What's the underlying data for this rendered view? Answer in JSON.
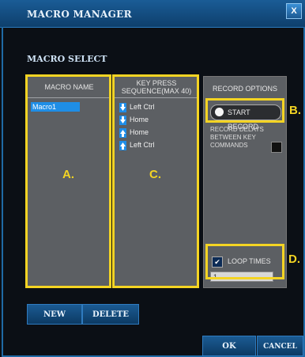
{
  "window": {
    "title": "MACRO MANAGER",
    "close_label": "X"
  },
  "section_title": "MACRO SELECT",
  "macro_list": {
    "header": "MACRO NAME",
    "items": [
      {
        "label": "Macro1",
        "selected": true
      }
    ]
  },
  "key_sequence": {
    "header_line1": "KEY PRESS",
    "header_line2": "SEQUENCE(MAX 40)",
    "rows": [
      {
        "direction": "down",
        "key": "Left Ctrl"
      },
      {
        "direction": "down",
        "key": "Home"
      },
      {
        "direction": "up",
        "key": "Home"
      },
      {
        "direction": "up",
        "key": "Left Ctrl"
      }
    ]
  },
  "record_options": {
    "title": "RECORD OPTIONS",
    "start_record_label": "START RECORD",
    "record_delays_label": "RECORD DELAYS BETWEEN KEY COMMANDS",
    "record_delays_checked": false,
    "loop_times_label": "LOOP TIMES",
    "loop_times_checked": true,
    "loop_times_value": "1"
  },
  "annotations": {
    "a": "A.",
    "b": "B.",
    "c": "C.",
    "d": "D."
  },
  "buttons": {
    "new": "NEW",
    "delete": "DELETE",
    "ok": "OK",
    "cancel": "CANCEL"
  },
  "colors": {
    "accent": "#1f6aa5",
    "highlight": "#f4d423",
    "arrow_down": "#1e8de8",
    "arrow_up": "#1e8de8"
  }
}
